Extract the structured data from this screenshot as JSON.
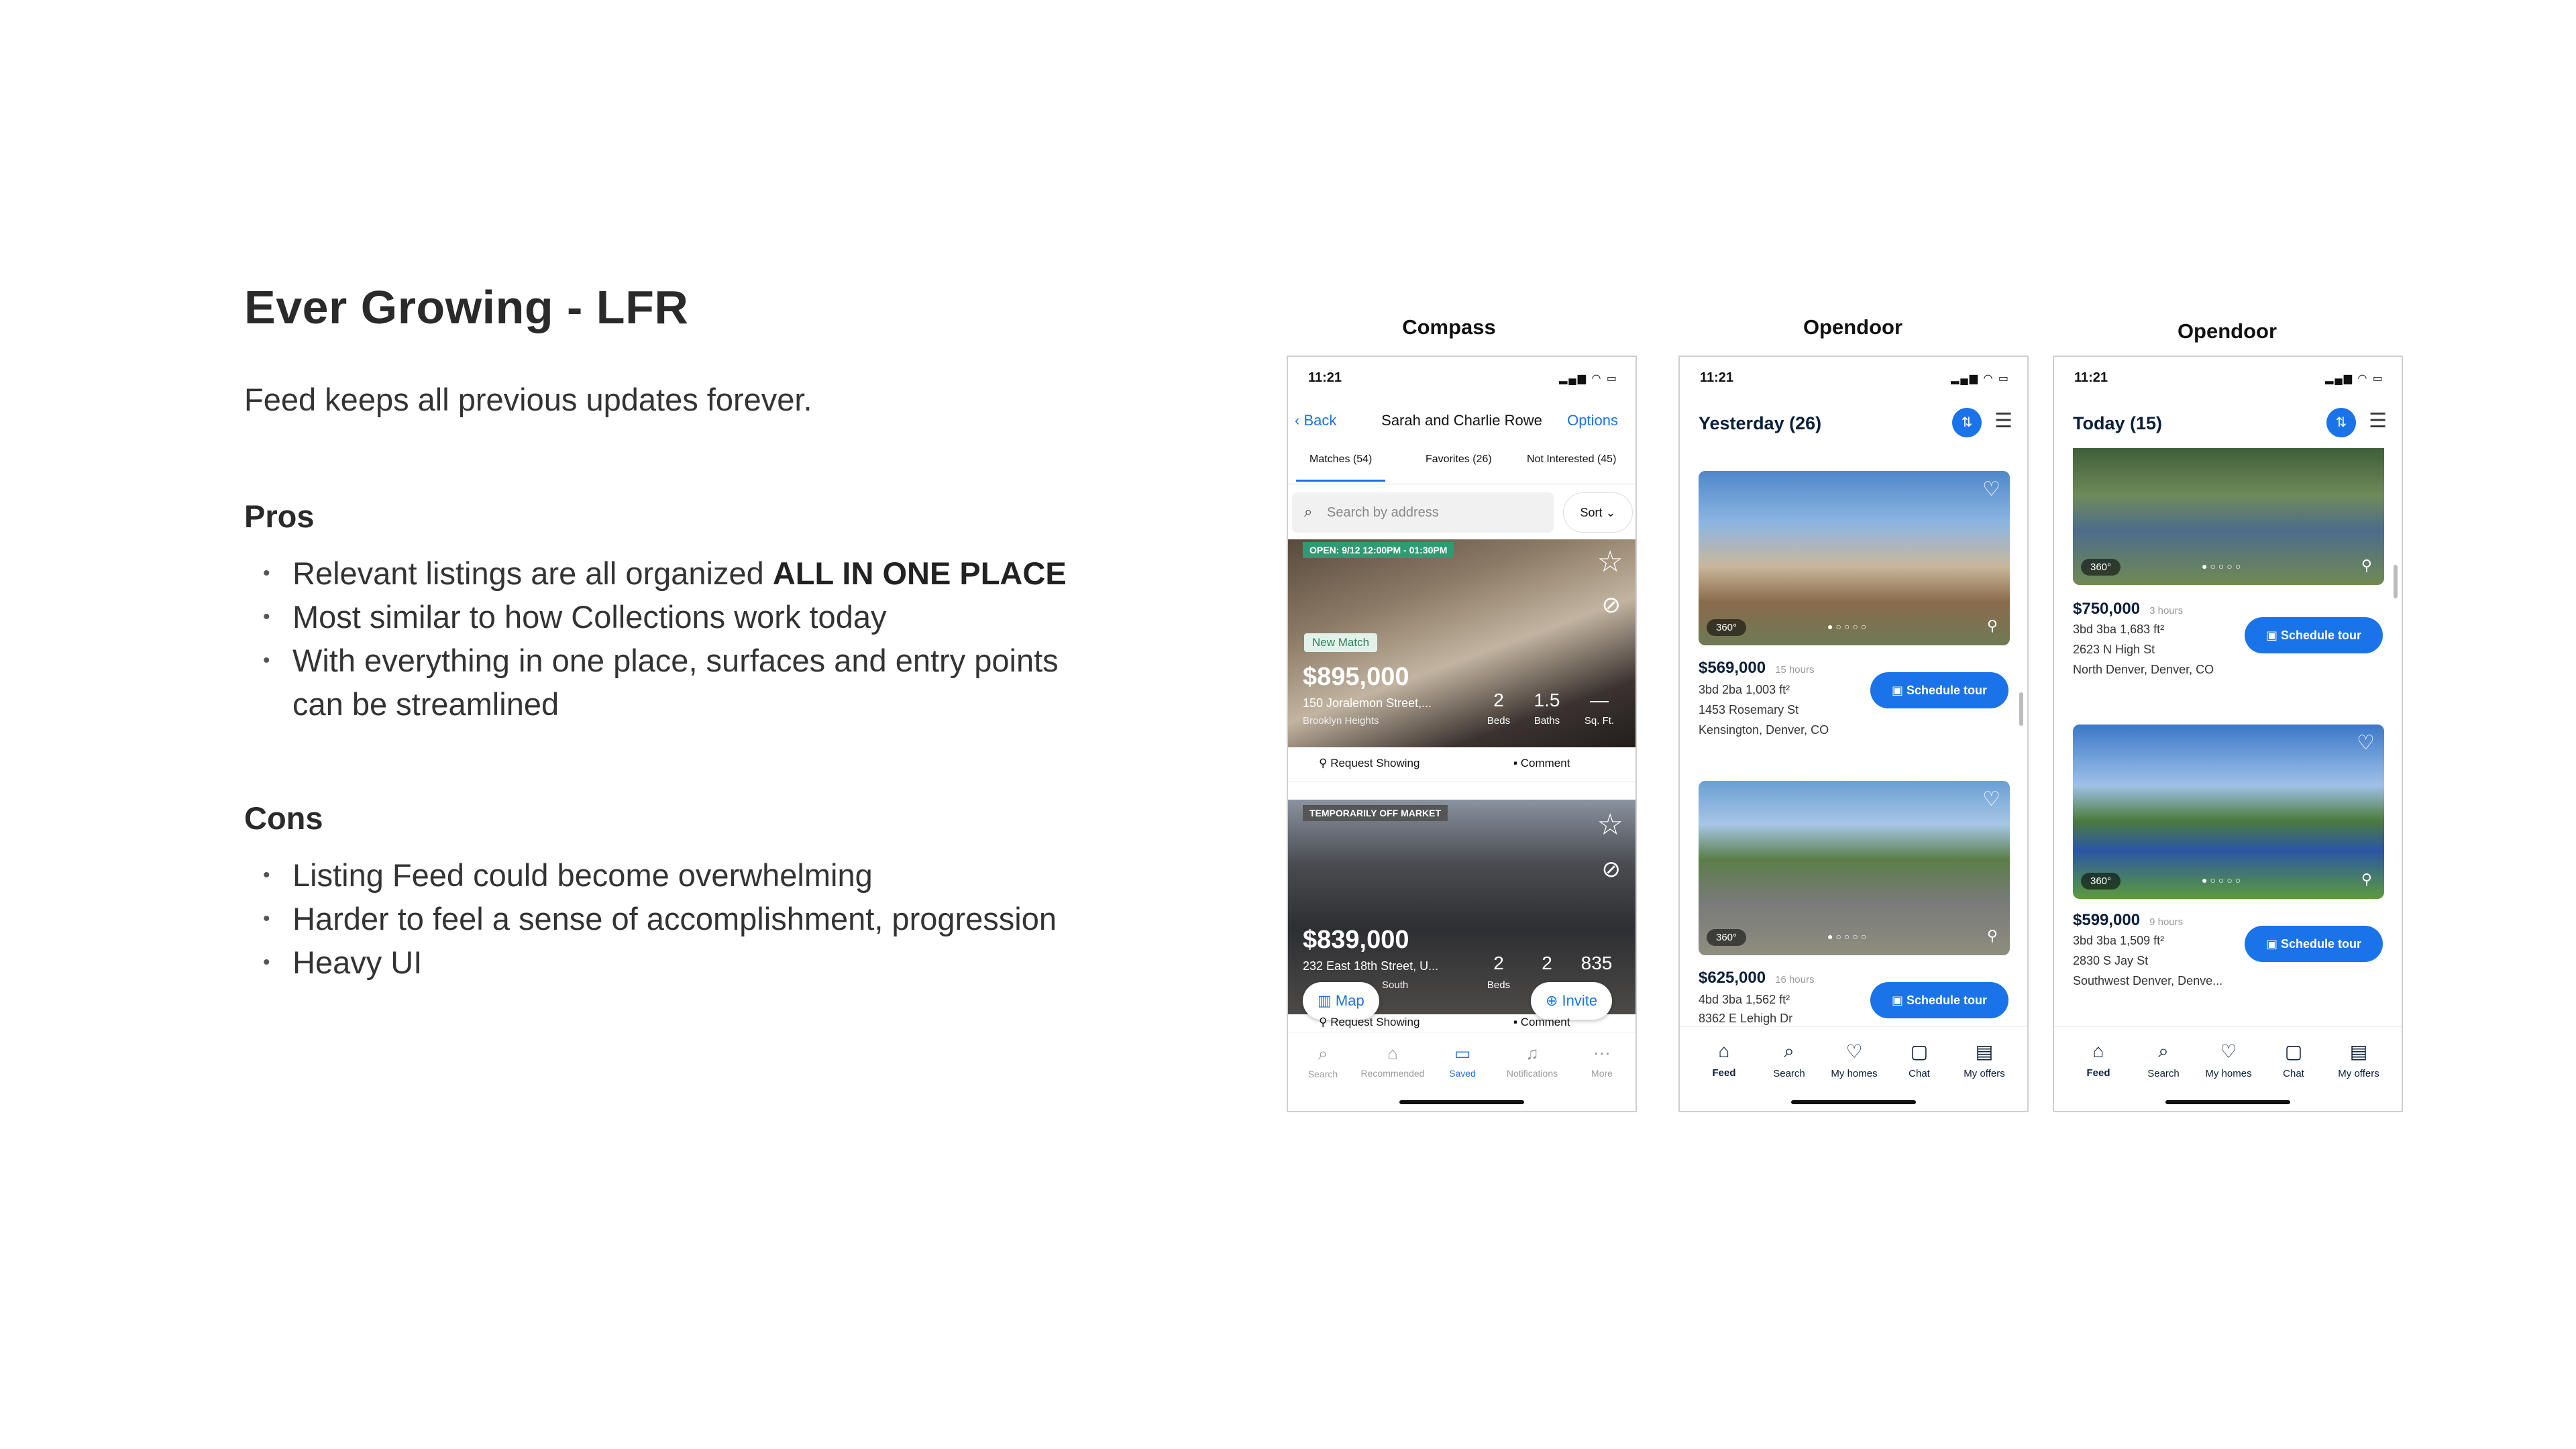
{
  "slide": {
    "title": "Ever Growing - LFR",
    "subtitle": "Feed keeps all previous updates forever.",
    "pros_heading": "Pros",
    "pros": [
      {
        "text": "Relevant listings are all organized ",
        "bold": "ALL IN ONE PLACE"
      },
      {
        "text": "Most similar to how Collections work today",
        "bold": ""
      },
      {
        "text": "With everything in one place, surfaces and entry points can be streamlined",
        "bold": ""
      }
    ],
    "cons_heading": "Cons",
    "cons": [
      "Listing Feed could become overwhelming",
      "Harder to feel a sense of accomplishment, progression",
      "Heavy UI"
    ]
  },
  "compass": {
    "label": "Compass",
    "time": "11:21",
    "back": "Back",
    "title": "Sarah and Charlie Rowe",
    "options": "Options",
    "tabs": [
      "Matches (54)",
      "Favorites (26)",
      "Not Interested (45)"
    ],
    "search_placeholder": "Search by address",
    "sort": "Sort",
    "listing1": {
      "open_badge": "OPEN: 9/12 12:00PM - 01:30PM",
      "new_badge": "New Match",
      "price": "$895,000",
      "address": "150 Joralemon Street,...",
      "hood": "Brooklyn Heights",
      "beds": "2",
      "beds_label": "Beds",
      "baths": "1.5",
      "baths_label": "Baths",
      "sqft": "—",
      "sqft_label": "Sq. Ft."
    },
    "actions": {
      "request": "Request Showing",
      "comment": "Comment"
    },
    "listing2": {
      "status_badge": "TEMPORARILY OFF MARKET",
      "price": "$839,000",
      "address": "232 East 18th Street, U...",
      "hood": "South",
      "beds": "2",
      "beds_label": "Beds",
      "baths": "2",
      "sqft": "835"
    },
    "map_btn": "Map",
    "invite_btn": "Invite",
    "nav": [
      "Search",
      "Recommended",
      "Saved",
      "Notifications",
      "More"
    ]
  },
  "opendoor1": {
    "label": "Opendoor",
    "time": "11:21",
    "heading": "Yesterday (26)",
    "listings": [
      {
        "price": "$569,000",
        "ago": "15 hours",
        "specs": "3bd  2ba  1,003 ft²",
        "street": "1453 Rosemary St",
        "area": "Kensington, Denver, CO"
      },
      {
        "price": "$625,000",
        "ago": "16 hours",
        "specs": "4bd  3ba  1,562 ft²",
        "street": "8362 E Lehigh Dr",
        "area": ""
      }
    ],
    "badge_360": "360°",
    "schedule": "Schedule tour",
    "nav": [
      "Feed",
      "Search",
      "My homes",
      "Chat",
      "My offers"
    ]
  },
  "opendoor2": {
    "label": "Opendoor",
    "time": "11:21",
    "heading": "Today (15)",
    "listings": [
      {
        "price": "$750,000",
        "ago": "3 hours",
        "specs": "3bd  3ba  1,683 ft²",
        "street": "2623 N High St",
        "area": "North Denver, Denver, CO"
      },
      {
        "price": "$599,000",
        "ago": "9 hours",
        "specs": "3bd  3ba  1,509 ft²",
        "street": "2830 S Jay St",
        "area": "Southwest Denver, Denve..."
      }
    ],
    "badge_360": "360°",
    "schedule": "Schedule tour",
    "nav": [
      "Feed",
      "Search",
      "My homes",
      "Chat",
      "My offers"
    ]
  }
}
